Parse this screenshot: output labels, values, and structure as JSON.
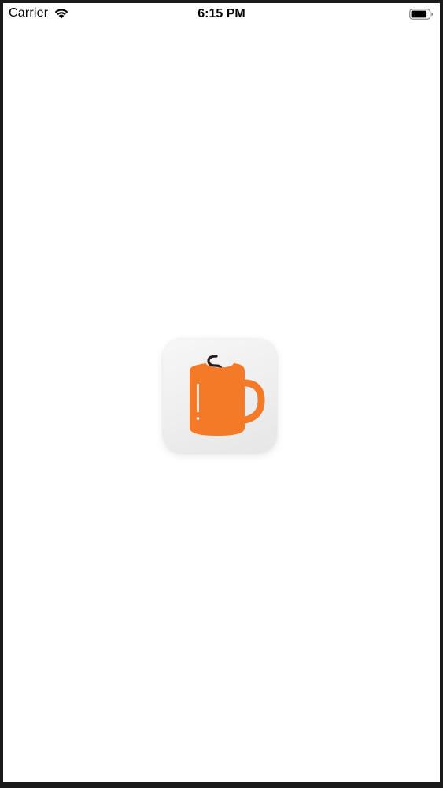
{
  "status_bar": {
    "carrier": "Carrier",
    "time": "6:15 PM",
    "wifi_icon": "wifi-icon",
    "battery_icon": "battery-icon"
  },
  "splash": {
    "app_icon": "coffee-mug-icon",
    "colors": {
      "mug": "#f47a28",
      "steam": "#2a1a1a",
      "highlight": "#ffffff",
      "icon_background": "#eeeeee"
    }
  }
}
